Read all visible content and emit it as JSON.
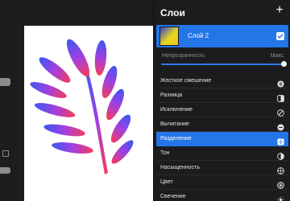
{
  "panel": {
    "title": "Слои",
    "add_icon": "plus-icon"
  },
  "layer": {
    "name": "Слой 2",
    "visible": true
  },
  "opacity": {
    "label": "Непрозрачность",
    "max_label": "Макс.",
    "value": 1.0
  },
  "blend_modes": [
    {
      "label": "Жесткое смешение",
      "icon": "hard-mix-icon",
      "selected": false
    },
    {
      "label": "Разница",
      "icon": "difference-icon",
      "selected": false
    },
    {
      "label": "Исключение",
      "icon": "exclusion-icon",
      "selected": false
    },
    {
      "label": "Вычитание",
      "icon": "subtract-icon",
      "selected": false
    },
    {
      "label": "Разделение",
      "icon": "divide-icon",
      "selected": true
    },
    {
      "label": "Тон",
      "icon": "hue-icon",
      "selected": false
    },
    {
      "label": "Насыщенность",
      "icon": "saturation-icon",
      "selected": false
    },
    {
      "label": "Цвет",
      "icon": "color-icon",
      "selected": false
    },
    {
      "label": "Свечение",
      "icon": "luminosity-icon",
      "selected": false
    }
  ],
  "colors": {
    "accent": "#2475e8",
    "panel_bg": "#1c1c1e",
    "leaf_top": "#3b58f0",
    "leaf_mid": "#a23fe0",
    "leaf_bottom": "#f53c5a"
  }
}
